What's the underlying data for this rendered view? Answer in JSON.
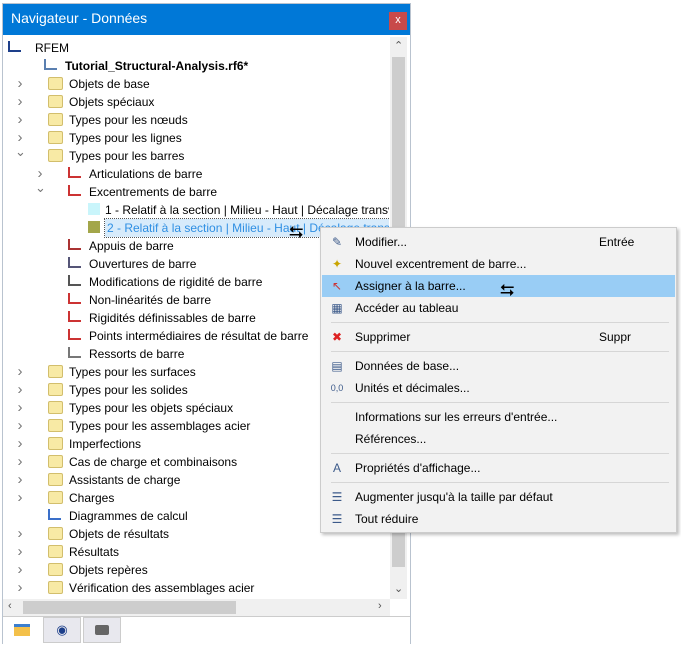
{
  "window": {
    "title": "Navigateur - Données",
    "close_label": "x"
  },
  "tree": [
    {
      "level": 0,
      "chev": "",
      "icon": "rfem-logo",
      "label": "RFEM"
    },
    {
      "level": 0,
      "chev": "down",
      "icon": "model-file",
      "label": "Tutorial_Structural-Analysis.rf6*",
      "bold": true
    },
    {
      "level": 1,
      "chev": "right",
      "icon": "folder",
      "label": "Objets de base"
    },
    {
      "level": 1,
      "chev": "right",
      "icon": "folder",
      "label": "Objets spéciaux"
    },
    {
      "level": 1,
      "chev": "right",
      "icon": "folder",
      "label": "Types pour les nœuds"
    },
    {
      "level": 1,
      "chev": "right",
      "icon": "folder",
      "label": "Types pour les lignes"
    },
    {
      "level": 1,
      "chev": "down",
      "icon": "folder",
      "label": "Types pour les barres"
    },
    {
      "level": 2,
      "chev": "right",
      "icon": "member-hinge",
      "label": "Articulations de barre"
    },
    {
      "level": 2,
      "chev": "down",
      "icon": "member-eccentricity",
      "label": "Excentrements de barre"
    },
    {
      "level": 3,
      "chev": "",
      "icon": "swatch",
      "color": "#c9f5fb",
      "label": "1 - Relatif à la section | Milieu - Haut | Décalage transversal"
    },
    {
      "level": 3,
      "chev": "",
      "icon": "swatch",
      "color": "#a3a64a",
      "label": "2 - Relatif à la section | Milieu - Haut | Décalage transversal",
      "selected": true
    },
    {
      "level": 2,
      "chev": "",
      "icon": "member-support",
      "label": "Appuis de barre"
    },
    {
      "level": 2,
      "chev": "",
      "icon": "member-opening",
      "label": "Ouvertures de barre"
    },
    {
      "level": 2,
      "chev": "",
      "icon": "stiffness-modification",
      "label": "Modifications de rigidité de barre"
    },
    {
      "level": 2,
      "chev": "",
      "icon": "nonlinearity",
      "label": "Non-linéarités de barre"
    },
    {
      "level": 2,
      "chev": "",
      "icon": "definable-stiffness",
      "label": "Rigidités définissables de barre"
    },
    {
      "level": 2,
      "chev": "",
      "icon": "result-points",
      "label": "Points intermédiaires de résultat de barre"
    },
    {
      "level": 2,
      "chev": "",
      "icon": "spring",
      "label": "Ressorts de barre"
    },
    {
      "level": 1,
      "chev": "right",
      "icon": "folder",
      "label": "Types pour les surfaces"
    },
    {
      "level": 1,
      "chev": "right",
      "icon": "folder",
      "label": "Types pour les solides"
    },
    {
      "level": 1,
      "chev": "right",
      "icon": "folder",
      "label": "Types pour les objets spéciaux"
    },
    {
      "level": 1,
      "chev": "right",
      "icon": "folder",
      "label": "Types pour les assemblages acier"
    },
    {
      "level": 1,
      "chev": "right",
      "icon": "folder",
      "label": "Imperfections"
    },
    {
      "level": 1,
      "chev": "right",
      "icon": "folder",
      "label": "Cas de charge et combinaisons"
    },
    {
      "level": 1,
      "chev": "right",
      "icon": "folder",
      "label": "Assistants de charge"
    },
    {
      "level": 1,
      "chev": "right",
      "icon": "folder",
      "label": "Charges"
    },
    {
      "level": 1,
      "chev": "",
      "icon": "diagram",
      "label": "Diagrammes de calcul"
    },
    {
      "level": 1,
      "chev": "right",
      "icon": "folder",
      "label": "Objets de résultats"
    },
    {
      "level": 1,
      "chev": "right",
      "icon": "folder",
      "label": "Résultats"
    },
    {
      "level": 1,
      "chev": "right",
      "icon": "folder",
      "label": "Objets repères"
    },
    {
      "level": 1,
      "chev": "right",
      "icon": "folder",
      "label": "Vérification des assemblages acier"
    }
  ],
  "tabs": [
    {
      "icon": "data-navigator-icon"
    },
    {
      "icon": "eye-icon"
    },
    {
      "icon": "camera-icon"
    }
  ],
  "context_menu": {
    "items": [
      {
        "label": "Modifier...",
        "shortcut": "Entrée",
        "icon": "edit"
      },
      {
        "label": "Nouvel excentrement de barre...",
        "icon": "new"
      },
      {
        "label": "Assigner à la barre...",
        "icon": "assign",
        "highlighted": true
      },
      {
        "label": "Accéder au tableau",
        "icon": "table"
      },
      {
        "sep": true
      },
      {
        "label": "Supprimer",
        "shortcut": "Suppr",
        "icon": "delete"
      },
      {
        "sep": true
      },
      {
        "label": "Données de base...",
        "icon": "base-data"
      },
      {
        "label": "Unités et décimales...",
        "icon": "units"
      },
      {
        "sep": true
      },
      {
        "label": "Informations sur les erreurs d'entrée..."
      },
      {
        "label": "Références..."
      },
      {
        "sep": true
      },
      {
        "label": "Propriétés d'affichage...",
        "icon": "display-properties"
      },
      {
        "sep": true
      },
      {
        "label": "Augmenter jusqu'à la taille par défaut",
        "icon": "expand"
      },
      {
        "label": "Tout réduire",
        "icon": "collapse"
      }
    ]
  },
  "colors": {
    "titlebar": "#0078d7",
    "close": "#c84a4a",
    "highlight": "#99cdf5",
    "selected_text": "#2f8fe3"
  }
}
